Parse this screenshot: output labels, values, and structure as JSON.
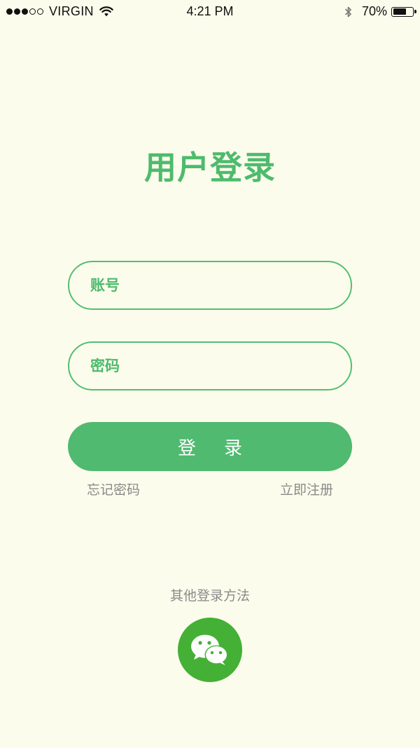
{
  "status_bar": {
    "carrier": "VIRGIN",
    "time": "4:21 PM",
    "battery_percent": "70%",
    "battery_level": 0.7,
    "signal_strength": 3,
    "signal_max": 5
  },
  "login": {
    "title": "用户登录",
    "account_placeholder": "账号",
    "password_placeholder": "密码",
    "login_button": "登录",
    "forgot_password": "忘记密码",
    "register": "立即注册",
    "other_methods": "其他登录方法",
    "wechat_icon": "wechat-icon"
  },
  "colors": {
    "background": "#fcfcec",
    "accent": "#4fba70",
    "wechat": "#44b035",
    "muted_text": "#8a8a8a"
  }
}
